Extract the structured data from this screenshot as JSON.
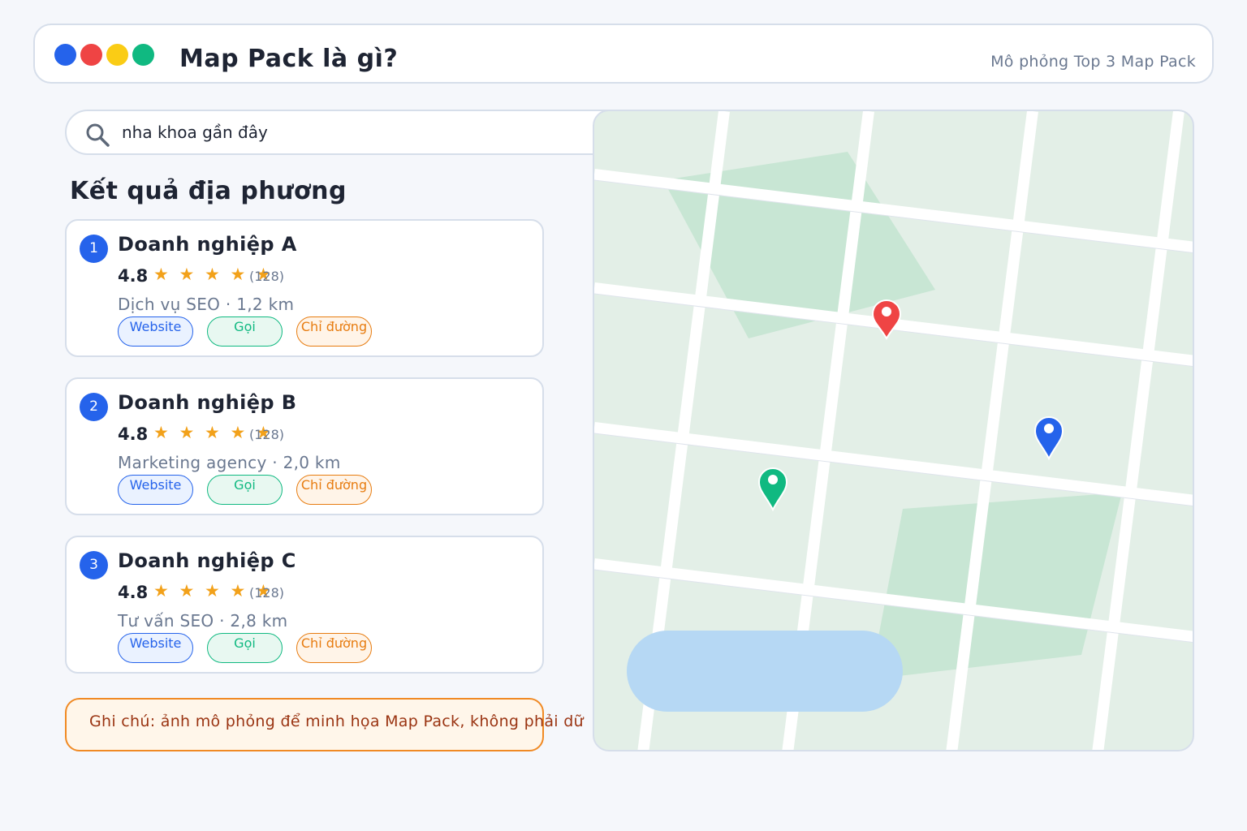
{
  "header": {
    "title": "Map Pack là gì?",
    "subtitle": "Mô phỏng Top 3 Map Pack",
    "dot_colors": [
      "#2563eb",
      "#ef4444",
      "#facc15",
      "#10b981"
    ]
  },
  "search": {
    "query": "nha khoa gần đây"
  },
  "section_title": "Kết quả địa phương",
  "results": [
    {
      "rank": "1",
      "name": "Doanh nghiệp A",
      "rating": "4.8",
      "stars": "★ ★ ★ ★ ★",
      "reviews": "(128)",
      "meta": "Dịch vụ SEO · 1,2 km",
      "buttons": {
        "website": "Website",
        "call": "Gọi",
        "directions": "Chỉ đường"
      }
    },
    {
      "rank": "2",
      "name": "Doanh nghiệp B",
      "rating": "4.8",
      "stars": "★ ★ ★ ★ ★",
      "reviews": "(128)",
      "meta": "Marketing agency · 2,0 km",
      "buttons": {
        "website": "Website",
        "call": "Gọi",
        "directions": "Chỉ đường"
      }
    },
    {
      "rank": "3",
      "name": "Doanh nghiệp C",
      "rating": "4.8",
      "stars": "★ ★ ★ ★ ★",
      "reviews": "(128)",
      "meta": "Tư vấn SEO · 2,8 km",
      "buttons": {
        "website": "Website",
        "call": "Gọi",
        "directions": "Chỉ đường"
      }
    }
  ],
  "note": "Ghi chú: ảnh mô phỏng để minh họa Map Pack, không phải dữ",
  "map": {
    "pin_colors": {
      "red": "#ef4444",
      "blue": "#2563eb",
      "green": "#10b981"
    },
    "park_color": "#c8e6d4",
    "water_color": "#b6d8f4",
    "road_color": "#ffffff"
  }
}
